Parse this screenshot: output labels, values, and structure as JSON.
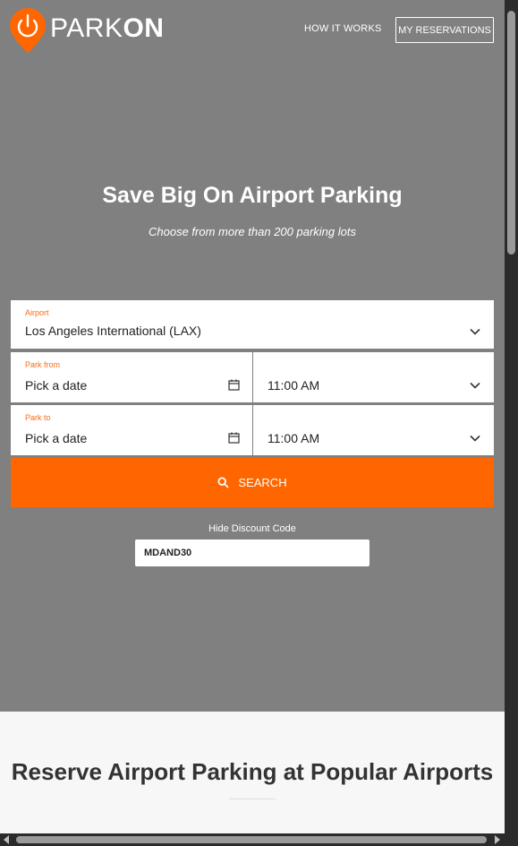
{
  "brand": {
    "name_thin": "PARK",
    "name_bold": "ON",
    "accent_color": "#ff6600"
  },
  "nav": {
    "how_it_works": "HOW IT WORKS",
    "my_reservations": "MY RESERVATIONS"
  },
  "hero": {
    "title": "Save Big On Airport Parking",
    "subtitle": "Choose from more than 200 parking lots"
  },
  "form": {
    "airport": {
      "label": "Airport",
      "value": "Los Angeles International (LAX)",
      "icon": "chevron-down-icon"
    },
    "park_from": {
      "label": "Park from",
      "date": "Pick a date",
      "time": "11:00 AM",
      "date_icon": "calendar-icon",
      "time_icon": "chevron-down-icon"
    },
    "park_to": {
      "label": "Park to",
      "date": "Pick a date",
      "time": "11:00 AM",
      "date_icon": "calendar-icon",
      "time_icon": "chevron-down-icon"
    },
    "search": {
      "label": "SEARCH",
      "icon": "search-icon"
    },
    "discount": {
      "toggle_label": "Hide Discount Code",
      "value": "MDAND30"
    }
  },
  "popular": {
    "title": "Reserve Airport Parking at Popular Airports"
  }
}
